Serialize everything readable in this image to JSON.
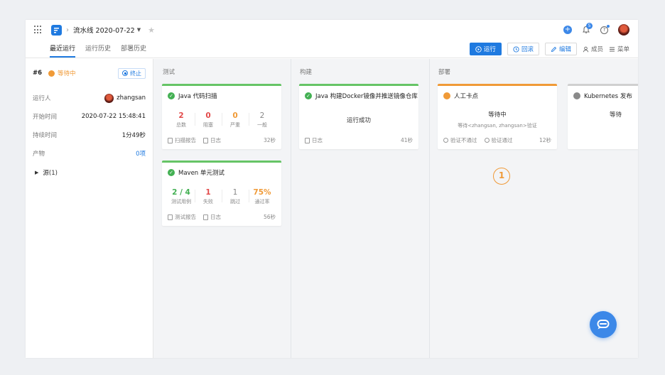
{
  "header": {
    "pipeline_title": "流水线 2020-07-22",
    "notification_count": "5"
  },
  "tabs": [
    {
      "label": "最近运行",
      "active": true
    },
    {
      "label": "运行历史",
      "active": false
    },
    {
      "label": "部署历史",
      "active": false
    }
  ],
  "actions": {
    "run": "运行",
    "rollback": "回滚",
    "edit": "编辑",
    "members": "成员",
    "menu": "菜单"
  },
  "run": {
    "number": "#6",
    "status": "等待中",
    "stop_label": "终止",
    "fields": [
      {
        "key": "运行人",
        "value": "zhangsan"
      },
      {
        "key": "开始时间",
        "value": "2020-07-22 15:48:41"
      },
      {
        "key": "持续时间",
        "value": "1分49秒"
      },
      {
        "key": "产物",
        "value": "0项"
      }
    ],
    "source_label": "源(1)"
  },
  "stages": [
    {
      "title": "测试",
      "jobs": [
        {
          "name": "Java 代码扫描",
          "stats": [
            {
              "n": "2",
              "label": "总数"
            },
            {
              "n": "0",
              "label": "阻塞"
            },
            {
              "n": "0",
              "label": "严重"
            },
            {
              "n": "2",
              "label": "一般"
            }
          ],
          "links": [
            "扫描报告",
            "日志"
          ],
          "duration": "32秒"
        },
        {
          "name": "Maven 单元测试",
          "stats": [
            {
              "n": "2 / 4",
              "label": "测试用例"
            },
            {
              "n": "1",
              "label": "失败"
            },
            {
              "n": "1",
              "label": "跳过"
            },
            {
              "n": "75%",
              "label": "通过率"
            }
          ],
          "links": [
            "测试报告",
            "日志"
          ],
          "duration": "56秒"
        }
      ]
    },
    {
      "title": "构建",
      "jobs": [
        {
          "name": "Java 构建Docker镜像并推送镜像仓库",
          "message": "运行成功",
          "links": [
            "日志"
          ],
          "duration": "41秒"
        }
      ]
    },
    {
      "title": "部署",
      "jobs": [
        {
          "name": "人工卡点",
          "message": "等待中",
          "sub_message": "等待<zhangsan, zhangsan>验证",
          "links": [
            "验证不通过",
            "验证通过"
          ],
          "duration": "12秒"
        },
        {
          "name": "Kubernetes 发布",
          "message": "等待"
        }
      ]
    }
  ],
  "step_marker": "1",
  "colors": {
    "primary": "#1f7ae0",
    "success": "#43b053",
    "warning": "#f09a37",
    "danger": "#e24a4a"
  }
}
